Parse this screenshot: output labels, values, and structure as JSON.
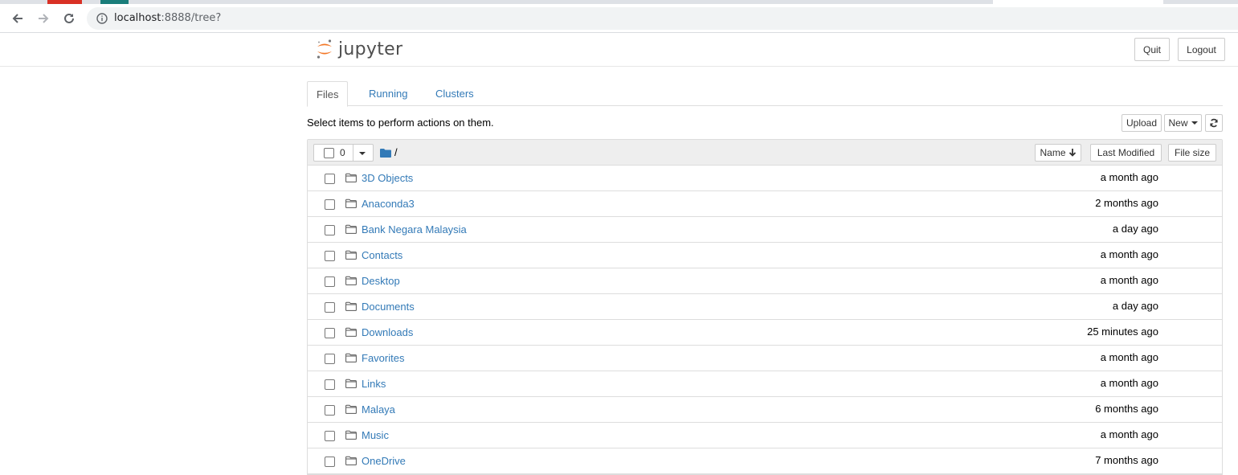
{
  "browser": {
    "url_host": "localhost",
    "url_rest": ":8888/tree?"
  },
  "header": {
    "logo_text": "jupyter",
    "quit_label": "Quit",
    "logout_label": "Logout"
  },
  "tabs": [
    {
      "label": "Files",
      "active": true
    },
    {
      "label": "Running",
      "active": false
    },
    {
      "label": "Clusters",
      "active": false
    }
  ],
  "instructions": "Select items to perform actions on them.",
  "actions": {
    "upload_label": "Upload",
    "new_label": "New"
  },
  "list_header": {
    "selected_count": "0",
    "breadcrumb_root": "/",
    "sort_name_label": "Name",
    "sort_modified_label": "Last Modified",
    "sort_size_label": "File size"
  },
  "files": [
    {
      "name": "3D Objects",
      "modified": "a month ago"
    },
    {
      "name": "Anaconda3",
      "modified": "2 months ago"
    },
    {
      "name": "Bank Negara Malaysia",
      "modified": "a day ago"
    },
    {
      "name": "Contacts",
      "modified": "a month ago"
    },
    {
      "name": "Desktop",
      "modified": "a month ago"
    },
    {
      "name": "Documents",
      "modified": "a day ago"
    },
    {
      "name": "Downloads",
      "modified": "25 minutes ago"
    },
    {
      "name": "Favorites",
      "modified": "a month ago"
    },
    {
      "name": "Links",
      "modified": "a month ago"
    },
    {
      "name": "Malaya",
      "modified": "6 months ago"
    },
    {
      "name": "Music",
      "modified": "a month ago"
    },
    {
      "name": "OneDrive",
      "modified": "7 months ago"
    }
  ],
  "colors": {
    "link": "#337ab7",
    "jupyter_orange": "#f37726"
  }
}
